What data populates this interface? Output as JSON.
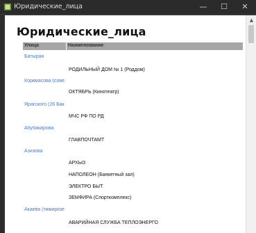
{
  "window": {
    "title": "Юридические_лица",
    "minimize": "—",
    "maximize": "☐",
    "close": "✕"
  },
  "report": {
    "title": "Юридические_лица",
    "columns": [
      "Улица",
      "Наименование"
    ],
    "rows": [
      {
        "street": "Батырая",
        "orgs": [
          "РОДИЛЬНЫЙ ДОМ № 1 (Роддом)"
        ]
      },
      {
        "street": "Коркмасова (сове",
        "orgs": [
          "ОКТЯБРЬ (Кинотеатр)"
        ]
      },
      {
        "street": "Ярагского (26 Бак",
        "orgs": [
          "МЧС РФ ПО РД"
        ]
      },
      {
        "street": "Абубакарова",
        "orgs": [
          "ГЛАВПОЧТАМТ"
        ]
      },
      {
        "street": "Азизова",
        "orgs": [
          "АРХЫЗ",
          "НАПОЛЕОН (Банкетный зал)",
          "ЭЛЕКТРО БЫТ",
          "ЗЕМФИРА (Спорткомплекс)"
        ]
      },
      {
        "street": "Акаева (тимирязе",
        "orgs": [
          "АВАРИЙНАЯ СЛУЖБА ТЕПЛОЭНЕРГО"
        ]
      }
    ]
  },
  "icons": {
    "app": "access-report-icon",
    "scroll_up": "scroll-up-arrow-icon"
  },
  "colors": {
    "street_link": "#4f79b9",
    "header_bg": "#a6a6a6"
  }
}
